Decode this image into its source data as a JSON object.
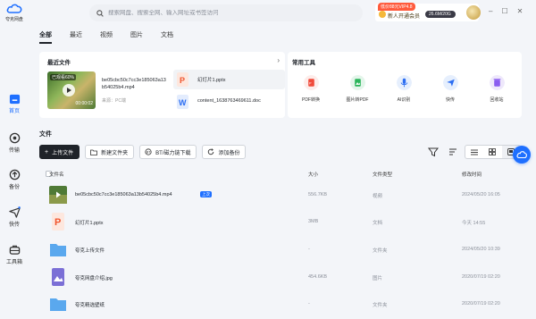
{
  "app": {
    "logo_label": "夸克网盘"
  },
  "nav": [
    {
      "id": "home",
      "label": "首页"
    },
    {
      "id": "transfer",
      "label": "传输"
    },
    {
      "id": "backup",
      "label": "备份"
    },
    {
      "id": "shortcut",
      "label": "快传"
    },
    {
      "id": "toolbox",
      "label": "工具箱"
    }
  ],
  "search": {
    "placeholder": "搜索网盘、搜索全网、输入网址或书签访问"
  },
  "promo": {
    "badge": "低价88元VIP4.8",
    "text": "新人开通会员",
    "quota": "26.6M/20G"
  },
  "tabs": [
    "全部",
    "最近",
    "视频",
    "图片",
    "文档"
  ],
  "recent": {
    "title": "最近文件",
    "more": "›",
    "video": {
      "progress_label": "已观看60%",
      "duration": "00:00:02",
      "name": "be05cbc50c7cc3e185063a13b54025b4.mp4",
      "source": "来源：PC端"
    },
    "files": [
      {
        "name": "幻灯片1.pptx"
      },
      {
        "name": "content_1638763469611.doc"
      }
    ]
  },
  "tools": {
    "title": "常用工具",
    "items": [
      {
        "label": "PDF转换",
        "icon": "pdf-convert-icon",
        "color": "#fdecea"
      },
      {
        "label": "图片转PDF",
        "icon": "image-to-pdf-icon",
        "color": "#e3f5ea"
      },
      {
        "label": "AI识别",
        "icon": "ai-recognize-icon",
        "color": "#e6effd"
      },
      {
        "label": "快传",
        "icon": "quick-transfer-icon",
        "color": "#e6effd"
      },
      {
        "label": "回收站",
        "icon": "recycle-bin-icon",
        "color": "#eee8fb"
      }
    ]
  },
  "files": {
    "title": "文件",
    "toolbar": {
      "upload": "上传文件",
      "new_folder": "新建文件夹",
      "bt_download": "BT/磁力链下载",
      "add_backup": "添加备份"
    },
    "columns": {
      "name": "文件名",
      "size": "大小",
      "type": "文件类型",
      "date": "修改时间"
    },
    "rows": [
      {
        "name": "be05cbc50c7cc3e185063a13b54025b4.mp4",
        "tag": "上次",
        "size": "556.7KB",
        "type": "视频",
        "date": "2024/05/20 16:05",
        "icon": "video-thumb-icon"
      },
      {
        "name": "幻灯片1.pptx",
        "size": "3MB",
        "type": "文档",
        "date": "今天 14:55",
        "icon": "pptx-file-icon"
      },
      {
        "name": "夸克上传文件",
        "size": "-",
        "type": "文件夹",
        "date": "2024/05/20 10:39",
        "icon": "folder-icon"
      },
      {
        "name": "夸克网盘介绍.jpg",
        "size": "454.6KB",
        "type": "图片",
        "date": "2020/07/19 02:20",
        "icon": "image-file-icon"
      },
      {
        "name": "夸克精选壁纸",
        "size": "-",
        "type": "文件夹",
        "date": "2020/07/19 02:20",
        "icon": "folder-icon"
      }
    ]
  },
  "colors": {
    "accent": "#1e6fff",
    "dark": "#1f2329",
    "bg": "#f3f5f9"
  }
}
